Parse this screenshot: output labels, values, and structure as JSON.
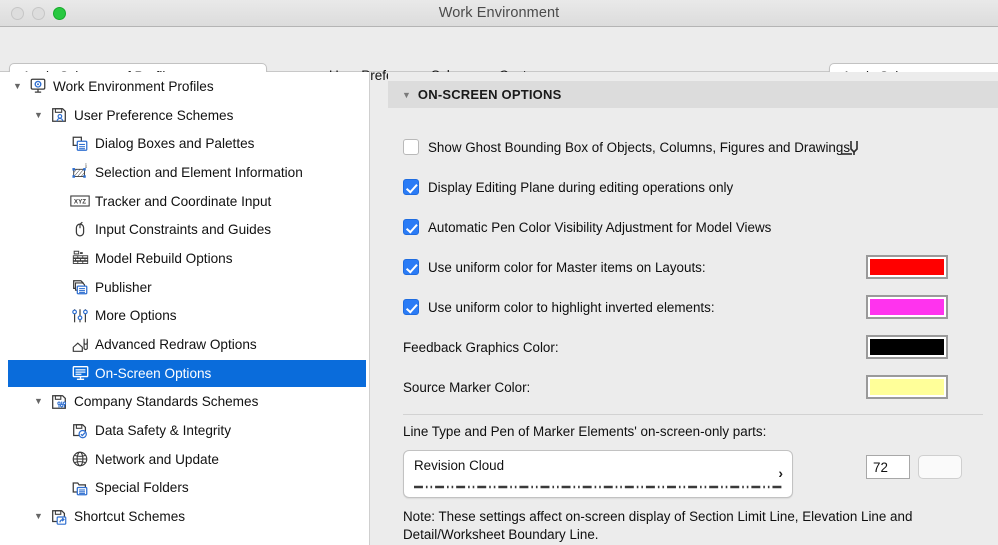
{
  "window": {
    "title": "Work Environment",
    "lights": [
      "close-gray",
      "minimize-gray",
      "zoom-green"
    ]
  },
  "toolbar": {
    "profile_button": "Apply Schemes of Profile:",
    "profile_chevron": "›",
    "center_label": "User Preference Schemes :",
    "center_value": "Custom",
    "scheme_button": "Apply Scheme:",
    "scheme_chevron": "›"
  },
  "sidebar": {
    "items": [
      {
        "label": "Work Environment Profiles",
        "icon": "monitor-gear-icon",
        "depth": 0,
        "twisty": "▼",
        "selected": false
      },
      {
        "label": "User Preference Schemes",
        "icon": "disk-person-icon",
        "depth": 1,
        "twisty": "▼",
        "selected": false
      },
      {
        "label": "Dialog Boxes and Palettes",
        "icon": "windows-icon",
        "depth": 2,
        "twisty": "",
        "selected": false
      },
      {
        "label": "Selection and Element Information",
        "icon": "selection-hatch-icon",
        "depth": 2,
        "twisty": "",
        "selected": false
      },
      {
        "label": "Tracker and Coordinate Input",
        "icon": "xyz-icon",
        "depth": 2,
        "twisty": "",
        "selected": false
      },
      {
        "label": "Input Constraints and Guides",
        "icon": "mouse-icon",
        "depth": 2,
        "twisty": "",
        "selected": false
      },
      {
        "label": "Model Rebuild Options",
        "icon": "brick-wall-icon",
        "depth": 2,
        "twisty": "",
        "selected": false
      },
      {
        "label": "Publisher",
        "icon": "publisher-icon",
        "depth": 2,
        "twisty": "",
        "selected": false
      },
      {
        "label": "More Options",
        "icon": "sliders-icon",
        "depth": 2,
        "twisty": "",
        "selected": false
      },
      {
        "label": "Advanced Redraw Options",
        "icon": "house-tool-icon",
        "depth": 2,
        "twisty": "",
        "selected": false
      },
      {
        "label": "On-Screen Options",
        "icon": "screen-icon",
        "depth": 2,
        "twisty": "",
        "selected": true
      },
      {
        "label": "Company Standards Schemes",
        "icon": "disk-sliders-icon",
        "depth": 1,
        "twisty": "▼",
        "selected": false
      },
      {
        "label": "Data Safety & Integrity",
        "icon": "disk-check-icon",
        "depth": 2,
        "twisty": "",
        "selected": false
      },
      {
        "label": "Network and Update",
        "icon": "globe-icon",
        "depth": 2,
        "twisty": "",
        "selected": false
      },
      {
        "label": "Special Folders",
        "icon": "folder-list-icon",
        "depth": 2,
        "twisty": "",
        "selected": false
      },
      {
        "label": "Shortcut Schemes",
        "icon": "disk-shortcut-icon",
        "depth": 1,
        "twisty": "▼",
        "selected": false
      }
    ],
    "selection_color": "#0a6cdb"
  },
  "panel": {
    "section": {
      "title": "ON-SCREEN OPTIONS",
      "twisty": "▼"
    },
    "checkboxes": [
      {
        "label": "Show Ghost Bounding Box of Objects, Columns, Figures and Drawings",
        "checked": false
      },
      {
        "label": "Display Editing Plane during editing operations only",
        "checked": true
      },
      {
        "label": "Automatic Pen Color Visibility Adjustment for Model Views",
        "checked": true
      },
      {
        "label": "Use uniform color for Master items on Layouts:",
        "checked": true,
        "swatch": "#FF0000"
      },
      {
        "label": "Use uniform color to highlight inverted elements:",
        "checked": true,
        "swatch": "#FF33EE"
      }
    ],
    "color_rows": [
      {
        "label": "Feedback Graphics Color:",
        "swatch": "#000000"
      },
      {
        "label": "Source Marker Color:",
        "swatch": "#FFFF99"
      }
    ],
    "linetype": {
      "label": "Line Type and Pen of Marker Elements' on-screen-only parts:",
      "value": "Revision Cloud",
      "chevron": "›",
      "pen_icon": "pen-nib-icon",
      "pen_value": "72",
      "pen_swatch": ""
    },
    "note": "Note: These settings affect on-screen display of Section Limit Line, Elevation Line and Detail/Worksheet Boundary Line."
  }
}
